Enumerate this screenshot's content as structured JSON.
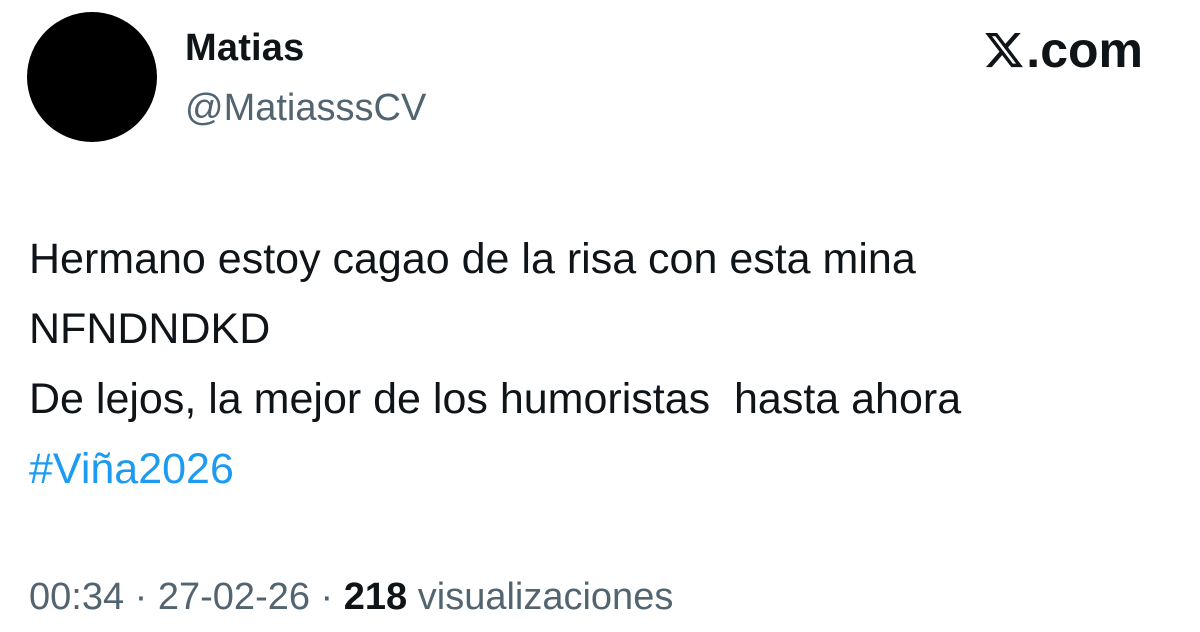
{
  "author": {
    "display_name": "Matias",
    "handle": "@MatiasssCV"
  },
  "brand": {
    "icon": "x-logo-icon",
    "domain": ".com"
  },
  "tweet": {
    "lines": [
      "Hermano estoy cagao de la risa con esta mina",
      "NFNDNDKD",
      "De lejos, la mejor de los humoristas  hasta ahora"
    ],
    "hashtag": "#Viña2026"
  },
  "meta": {
    "time": "00:34",
    "separator": " · ",
    "date": "27-02-26",
    "views_count": "218",
    "views_label": "visualizaciones"
  },
  "colors": {
    "text": "#0f1419",
    "secondary": "#536471",
    "link": "#1d9bf0",
    "avatar": "#000000"
  }
}
